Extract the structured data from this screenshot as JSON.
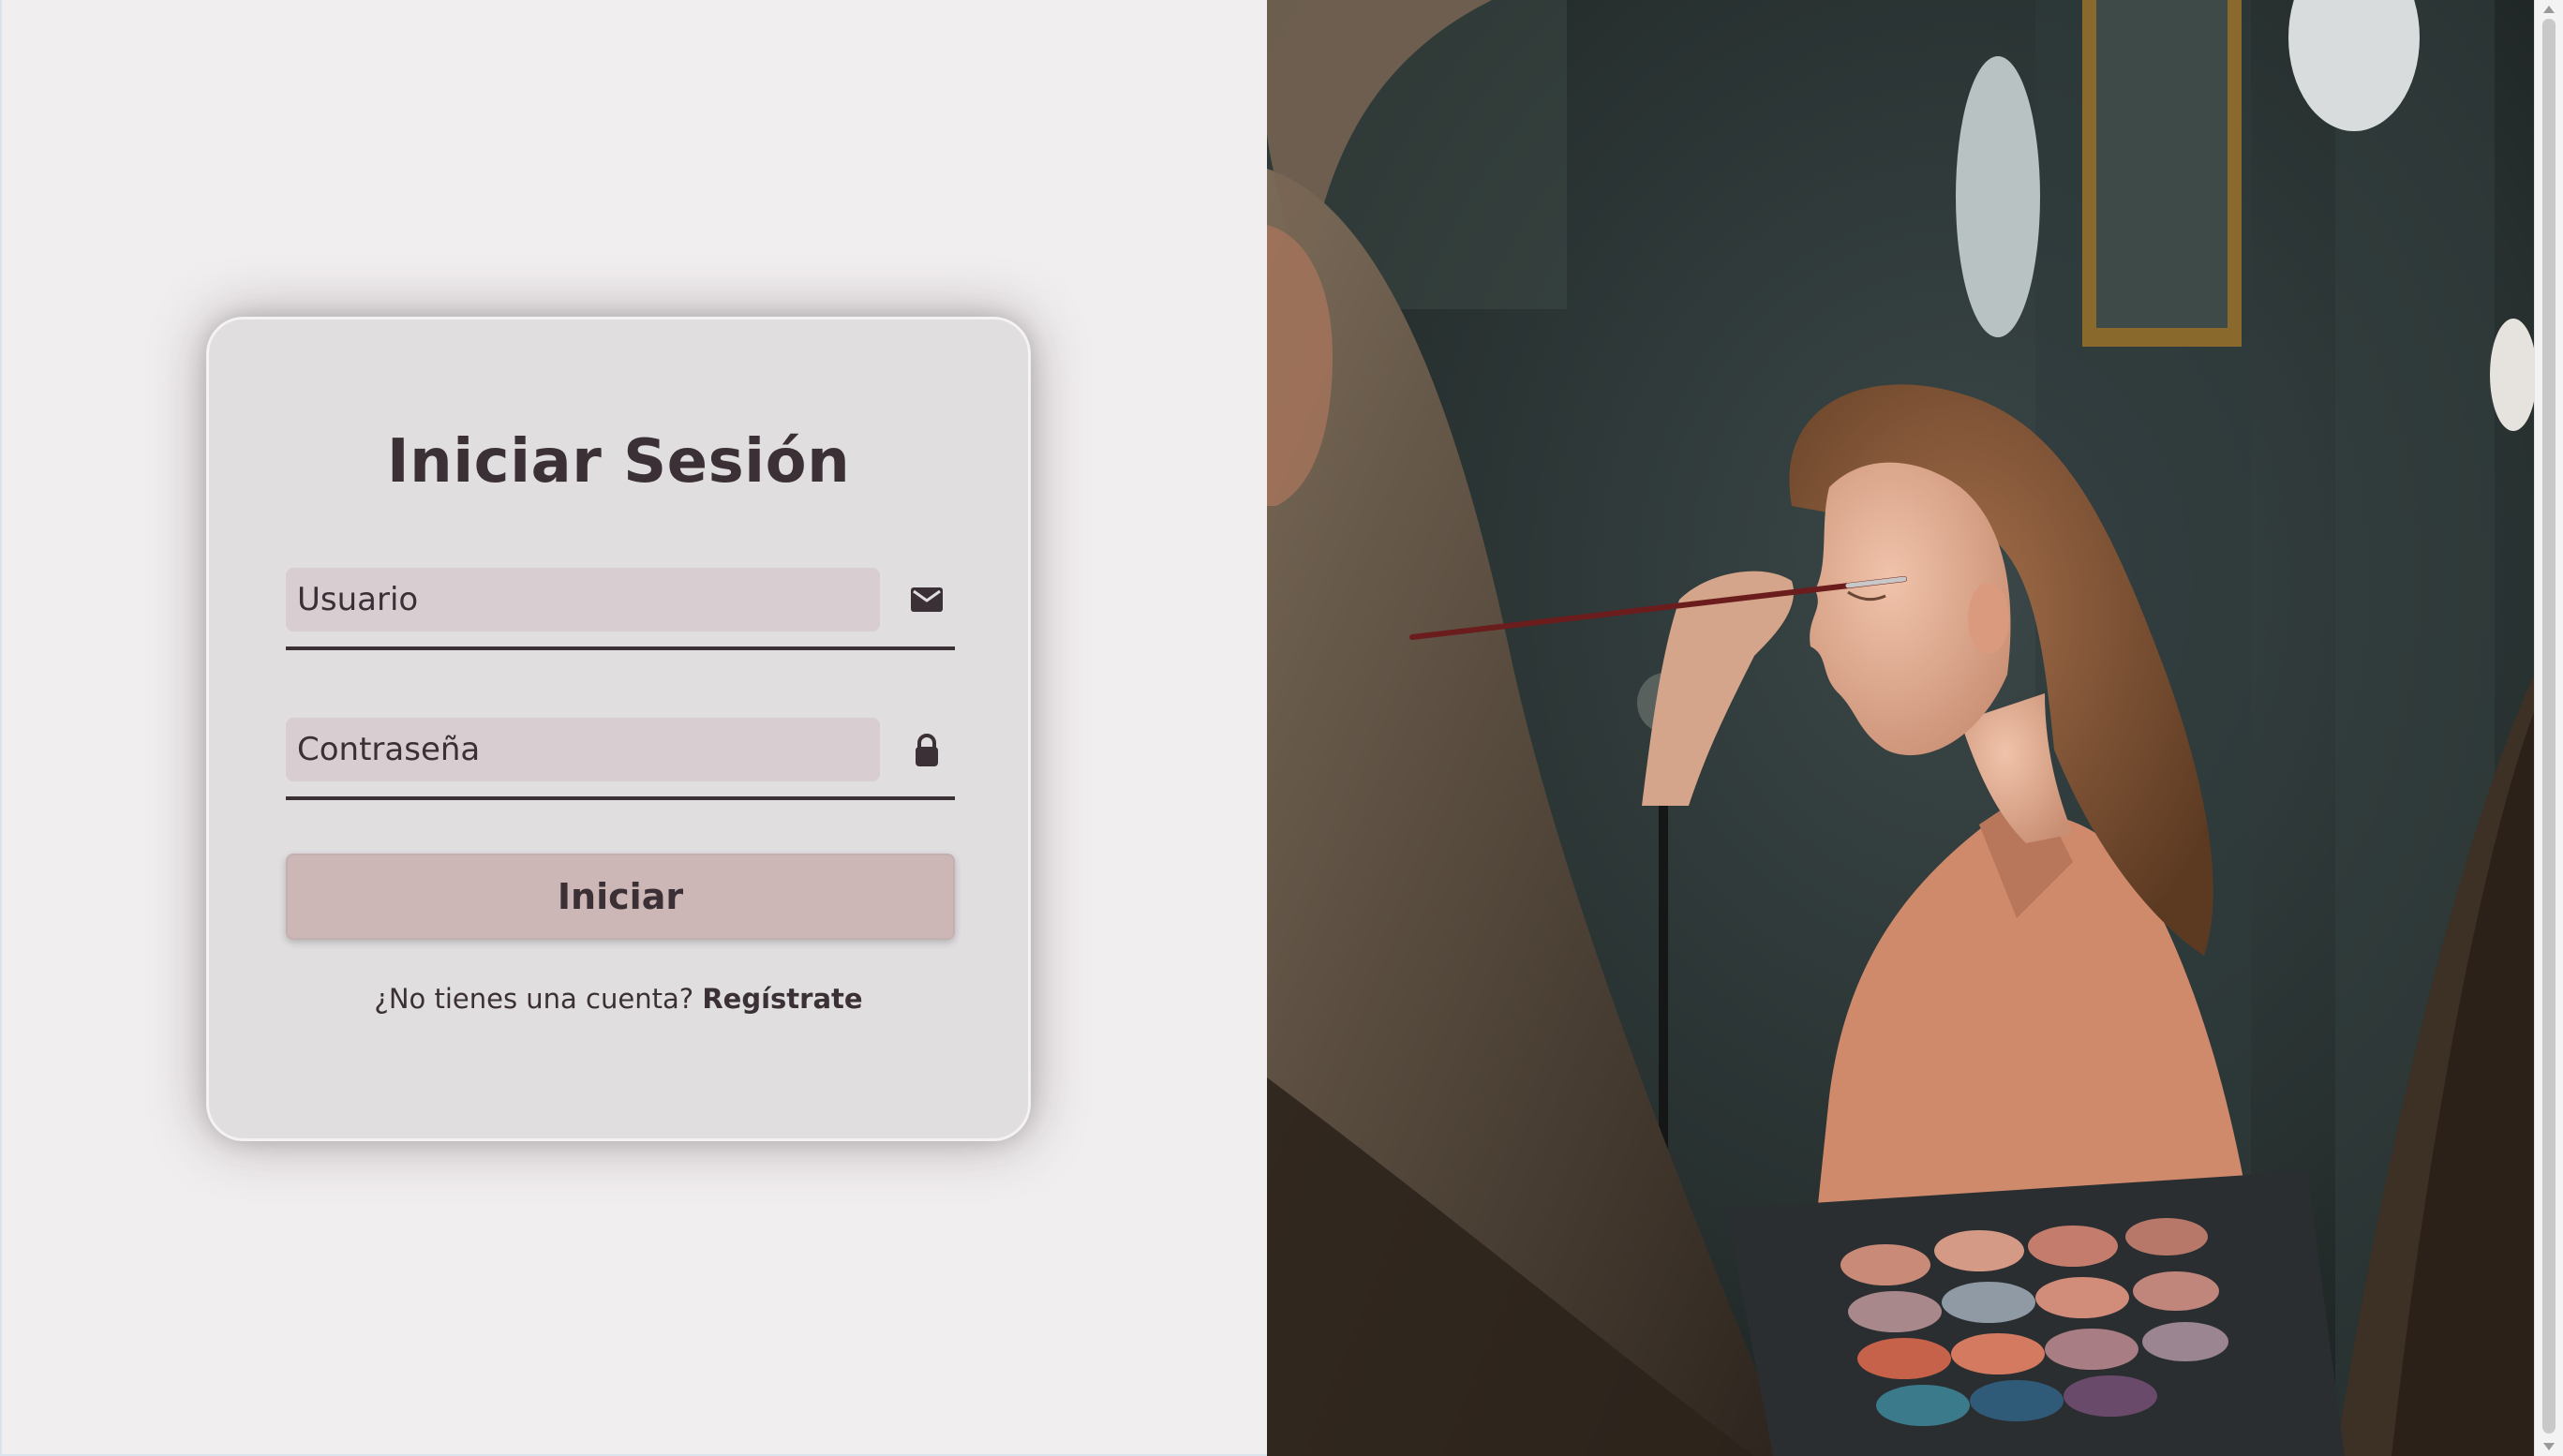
{
  "login": {
    "title": "Iniciar Sesión",
    "username_placeholder": "Usuario",
    "password_placeholder": "Contraseña",
    "submit_label": "Iniciar",
    "signup_prompt": "¿No tienes una cuenta?",
    "signup_link": "Regístrate"
  },
  "icons": {
    "username": "envelope-icon",
    "password": "lock-icon"
  },
  "colors": {
    "page_background": "#f1eeef",
    "card_background": "#e0dedf",
    "input_background": "#d8cdd0",
    "button_background": "#ccb7b6",
    "text": "#3b3036"
  }
}
